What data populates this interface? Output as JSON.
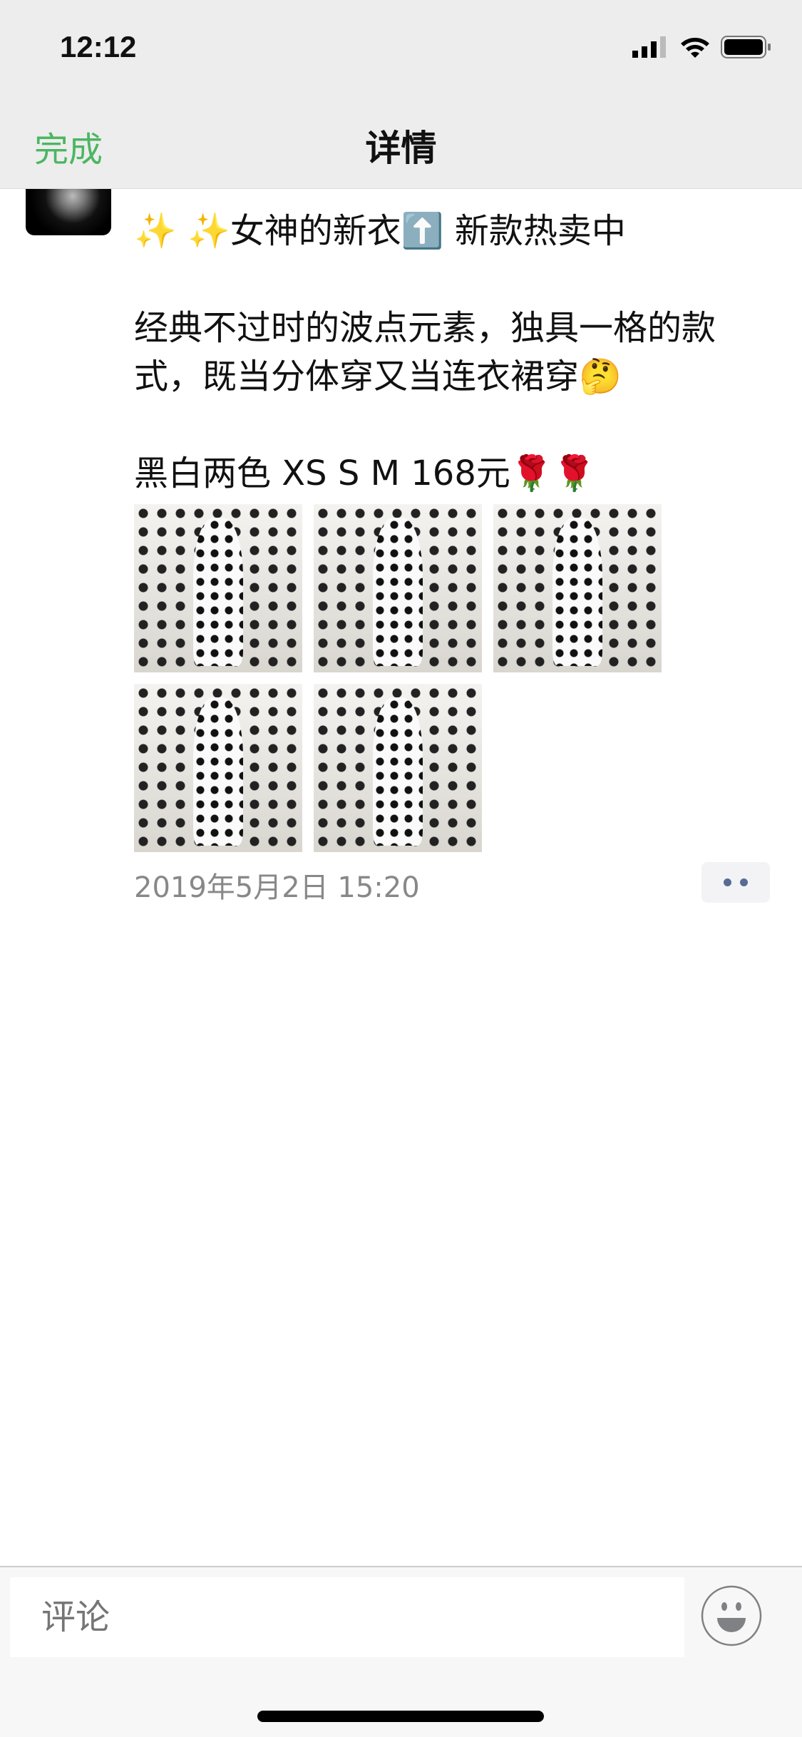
{
  "status_bar": {
    "time": "12:12"
  },
  "nav": {
    "done_label": "完成",
    "title": "详情"
  },
  "post": {
    "paragraphs": [
      "✨ ✨女神的新衣⬆️ 新款热卖中",
      "经典不过时的波点元素，独具一格的款式，既当分体穿又当连衣裙穿🤔",
      "黑白两色   XS S M   168元🌹🌹"
    ],
    "image_count": 5,
    "timestamp": "2019年5月2日 15:20"
  },
  "comment": {
    "placeholder": "评论"
  },
  "colors": {
    "accent": "#4cb662",
    "link": "#576b95"
  }
}
